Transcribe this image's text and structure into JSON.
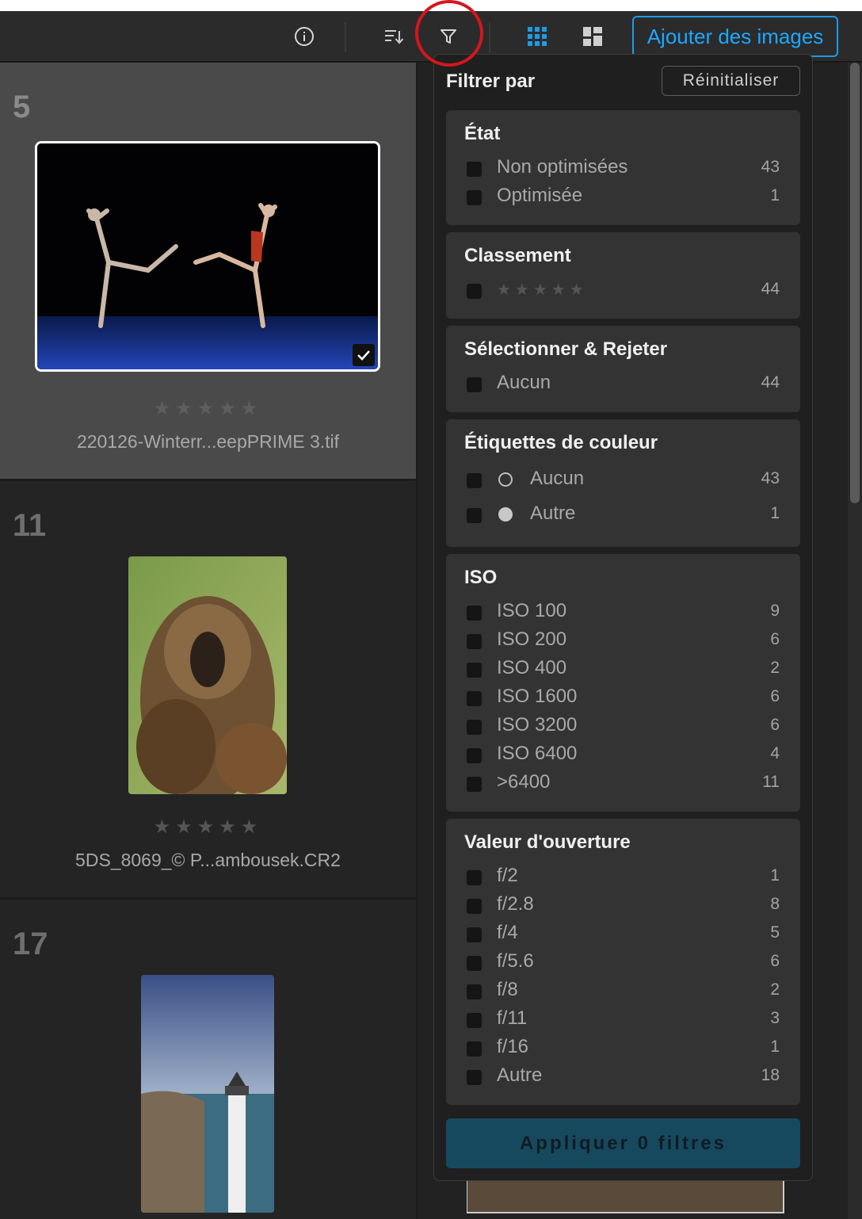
{
  "toolbar": {
    "add_images_label": "Ajouter des images",
    "icons": [
      "info-icon",
      "sort-icon",
      "filter-icon",
      "grid-view-icon",
      "mosaic-view-icon"
    ]
  },
  "grid": {
    "cells": [
      {
        "number": "5",
        "rating": "★★★★★",
        "filename": "220126-Winterr...eepPRIME 3.tif",
        "selected": true
      },
      {
        "number": "11",
        "rating": "★★★★★",
        "filename": "5DS_8069_© P...ambousek.CR2",
        "selected": false
      },
      {
        "number": "17",
        "rating": "",
        "filename": "",
        "selected": false
      }
    ]
  },
  "filter": {
    "title": "Filtrer par",
    "reset_label": "Réinitialiser",
    "apply_label": "Appliquer 0 filtres",
    "sections": {
      "state": {
        "title": "État",
        "rows": [
          {
            "label": "Non optimisées",
            "count": "43"
          },
          {
            "label": "Optimisée",
            "count": "1"
          }
        ]
      },
      "rating": {
        "title": "Classement",
        "rows": [
          {
            "label": "★★★★★",
            "count": "44"
          }
        ]
      },
      "pick_reject": {
        "title": "Sélectionner & Rejeter",
        "rows": [
          {
            "label": "Aucun",
            "count": "44"
          }
        ]
      },
      "color_labels": {
        "title": "Étiquettes de couleur",
        "rows": [
          {
            "label": "Aucun",
            "count": "43"
          },
          {
            "label": "Autre",
            "count": "1"
          }
        ]
      },
      "iso": {
        "title": "ISO",
        "rows": [
          {
            "label": "ISO 100",
            "count": "9"
          },
          {
            "label": "ISO 200",
            "count": "6"
          },
          {
            "label": "ISO 400",
            "count": "2"
          },
          {
            "label": "ISO 1600",
            "count": "6"
          },
          {
            "label": "ISO 3200",
            "count": "6"
          },
          {
            "label": "ISO 6400",
            "count": "4"
          },
          {
            "label": ">6400",
            "count": "11"
          }
        ]
      },
      "aperture": {
        "title": "Valeur d'ouverture",
        "rows": [
          {
            "label": "f/2",
            "count": "1"
          },
          {
            "label": "f/2.8",
            "count": "8"
          },
          {
            "label": "f/4",
            "count": "5"
          },
          {
            "label": "f/5.6",
            "count": "6"
          },
          {
            "label": "f/8",
            "count": "2"
          },
          {
            "label": "f/11",
            "count": "3"
          },
          {
            "label": "f/16",
            "count": "1"
          },
          {
            "label": "Autre",
            "count": "18"
          }
        ]
      }
    }
  },
  "colors": {
    "accent": "#1ea7ff",
    "apply_bg": "#17495e",
    "highlight": "#d4161c"
  }
}
